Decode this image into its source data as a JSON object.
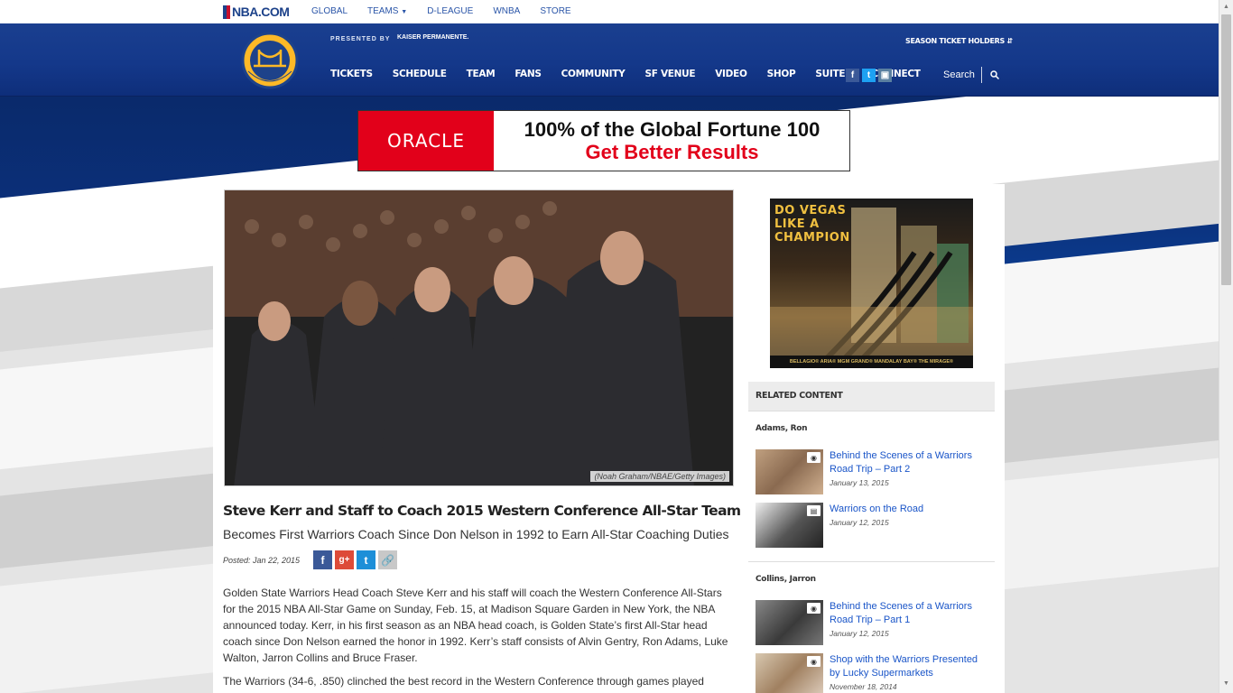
{
  "topbar": {
    "logo": "NBA.COM",
    "links": [
      "GLOBAL",
      "TEAMS",
      "D-LEAGUE",
      "WNBA",
      "STORE"
    ]
  },
  "header": {
    "presented_by": "PRESENTED BY",
    "sponsor": "KAISER PERMANENTE.",
    "season_ticket": "SEASON TICKET HOLDERS",
    "nav": [
      "TICKETS",
      "SCHEDULE",
      "TEAM",
      "FANS",
      "COMMUNITY",
      "SF VENUE",
      "VIDEO",
      "SHOP",
      "SUITES",
      "CONNECT"
    ],
    "social": [
      "facebook-icon",
      "twitter-icon",
      "instagram-icon"
    ],
    "search_label": "Search"
  },
  "banner_ad": {
    "brand": "ORACLE",
    "line1": "100% of the Global Fortune 100",
    "line2": "Get Better Results"
  },
  "article": {
    "photo_caption": "(Noah Graham/NBAE/Getty Images)",
    "title": "Steve Kerr and Staff to Coach 2015 Western Conference All-Star Team",
    "subtitle": "Becomes First Warriors Coach Since Don Nelson in 1992 to Earn All-Star Coaching Duties",
    "posted": "Posted: Jan 22, 2015",
    "share": [
      "facebook-share",
      "google-plus-share",
      "twitter-share",
      "link-share"
    ],
    "paragraph1": "Golden State Warriors Head Coach Steve Kerr and his staff will coach the Western Conference All-Stars for the 2015 NBA All-Star Game on Sunday, Feb. 15, at Madison Square Garden in New York, the NBA announced today. Kerr, in his first season as an NBA head coach, is Golden State’s first All-Star head coach since Don Nelson earned the honor in 1992. Kerr’s staff consists of Alvin Gentry, Ron Adams, Luke Walton, Jarron Collins and Bruce Fraser.",
    "paragraph2": "The Warriors (34-6, .850) clinched the best record in the Western Conference through games played"
  },
  "side_ad": {
    "headline_1": "DO VEGAS",
    "headline_2": "LIKE A",
    "headline_3": "CHAMPION",
    "footer": "BELLAGIO® ARIA® MGM GRAND® MANDALAY BAY® THE MIRAGE®"
  },
  "related": {
    "header": "RELATED CONTENT",
    "groups": [
      {
        "name": "Adams, Ron",
        "items": [
          {
            "title": "Behind the Scenes of a Warriors Road Trip – Part 2",
            "date": "January 13, 2015",
            "type": "camera-icon"
          },
          {
            "title": "Warriors on the Road",
            "date": "January 12, 2015",
            "type": "article-icon"
          }
        ]
      },
      {
        "name": "Collins, Jarron",
        "items": [
          {
            "title": "Behind the Scenes of a Warriors Road Trip – Part 1",
            "date": "January 12, 2015",
            "type": "camera-icon"
          },
          {
            "title": "Shop with the Warriors Presented by Lucky Supermarkets",
            "date": "November 18, 2014",
            "type": "camera-icon"
          }
        ]
      }
    ]
  },
  "colors": {
    "warriors_blue": "#1d428a",
    "warriors_gold": "#fdb927",
    "link_blue": "#1a55c8",
    "oracle_red": "#e2001a"
  }
}
